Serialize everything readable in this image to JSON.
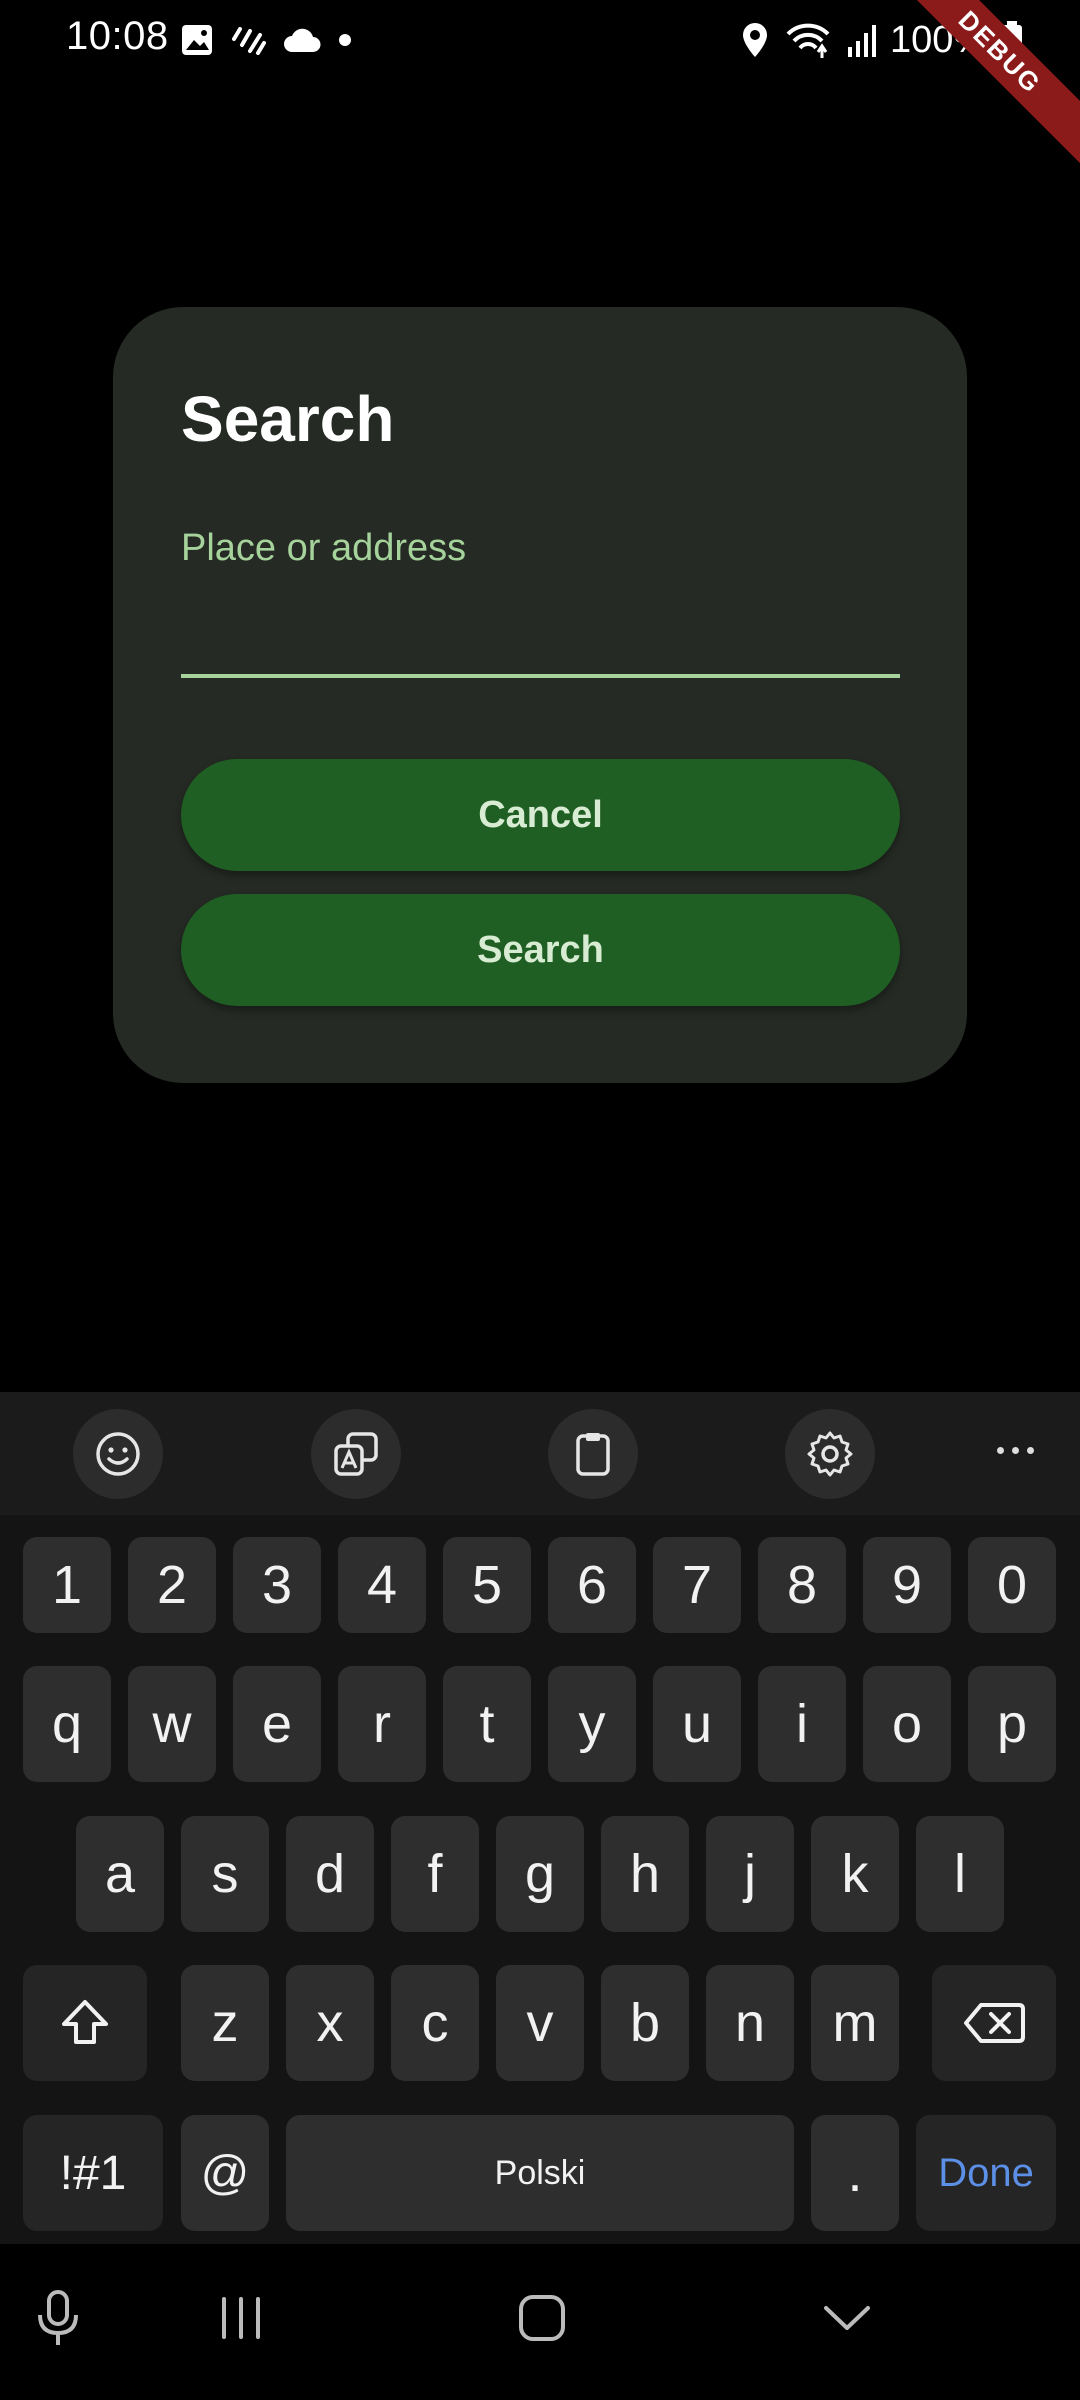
{
  "status_bar": {
    "time": "10:08",
    "battery": "100%",
    "debug_label": "DEBUG"
  },
  "dialog": {
    "title": "Search",
    "field_label": "Place or address",
    "field_value": "",
    "cancel_label": "Cancel",
    "search_label": "Search"
  },
  "keyboard": {
    "toolbar_icons": [
      "emoji-icon",
      "translate-icon",
      "clipboard-icon",
      "settings-icon",
      "more-icon"
    ],
    "rows": {
      "numbers": [
        "1",
        "2",
        "3",
        "4",
        "5",
        "6",
        "7",
        "8",
        "9",
        "0"
      ],
      "row1": [
        "q",
        "w",
        "e",
        "r",
        "t",
        "y",
        "u",
        "i",
        "o",
        "p"
      ],
      "row2": [
        "a",
        "s",
        "d",
        "f",
        "g",
        "h",
        "j",
        "k",
        "l"
      ],
      "row3": [
        "z",
        "x",
        "c",
        "v",
        "b",
        "n",
        "m"
      ]
    },
    "symbols_label": "!#1",
    "at_label": "@",
    "space_label": "Polski",
    "period_label": ".",
    "done_label": "Done"
  },
  "colors": {
    "accent": "#a6d39b",
    "button": "#1f5f23",
    "dialog_bg": "#252a24",
    "done": "#5c8fe6"
  }
}
